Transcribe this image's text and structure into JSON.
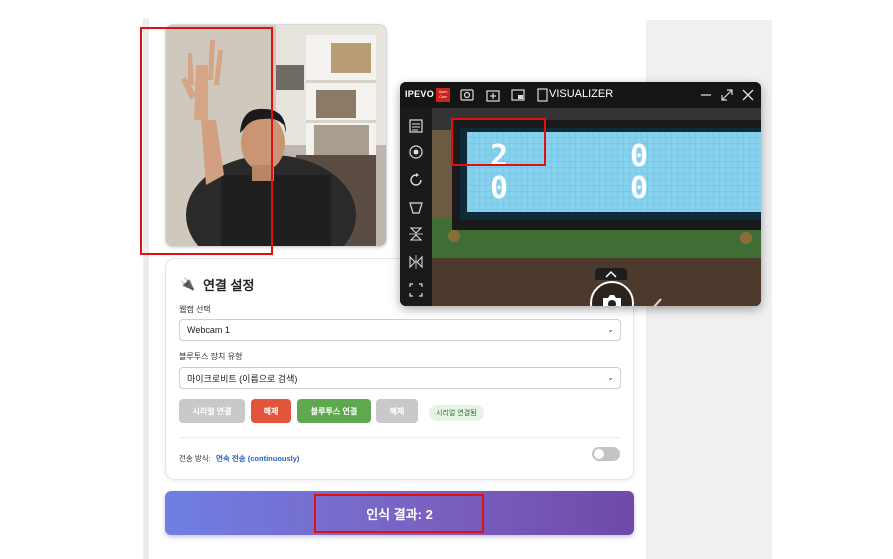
{
  "visualizer": {
    "logo": "IPEVO",
    "oc_badge": "Open Cam",
    "title": "VISUALIZER",
    "icons": [
      "settings-icon",
      "add-source-icon",
      "pip-icon",
      "window-icon"
    ],
    "window_controls": [
      "minimize-icon",
      "maximize-icon",
      "close-icon"
    ],
    "sidebar_icons": [
      "document-icon",
      "camera-focus-icon",
      "rotate-icon",
      "perspective-icon",
      "flip-vertical-icon",
      "mirror-icon",
      "crop-icon"
    ],
    "lcd": {
      "row1": "2        0",
      "row2": "0        0"
    }
  },
  "settings": {
    "title": "연결 설정",
    "webcam_label": "웹캠 선택",
    "webcam_value": "Webcam 1",
    "bt_label": "블루투스 장치 유형",
    "bt_value": "마이크로비트 (이름으로 검색)",
    "buttons": {
      "serial_connect": "시리얼 연결",
      "serial_disconnect": "해제",
      "bt_connect": "블루투스 연결",
      "bt_disconnect": "해제"
    },
    "status_badge": "시리얼 연결됨",
    "transfer_label": "전송 방식:",
    "transfer_value": "연속 전송 (continuously)",
    "transfer_toggle_on": false
  },
  "result": {
    "text": "인식 결과: 2"
  },
  "colors": {
    "accent_red": "#e2553a",
    "accent_green": "#5fa84e",
    "gradient_start": "#6f7fe3",
    "gradient_end": "#6f4aa7",
    "annotation": "#e01010"
  }
}
